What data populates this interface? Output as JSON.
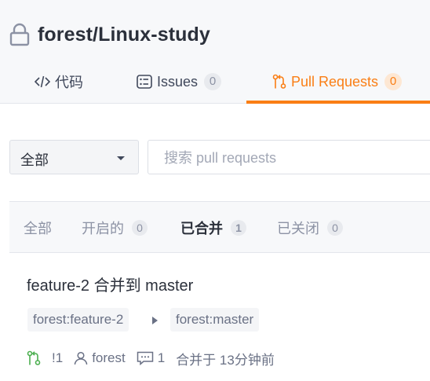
{
  "repo": {
    "title": "forest/Linux-study",
    "icon": "lock-icon"
  },
  "tabs": [
    {
      "label": "代码",
      "icon": "code-icon"
    },
    {
      "label": "Issues",
      "count": "0",
      "icon": "issues-icon"
    },
    {
      "label": "Pull Requests",
      "count": "0",
      "icon": "pull-request-icon",
      "active": true
    }
  ],
  "colors": {
    "accent": "#fa7e14",
    "merged_icon": "#4caf50"
  },
  "toolbar": {
    "select_value": "全部",
    "search_placeholder": "搜索 pull requests"
  },
  "filters": [
    {
      "label": "全部"
    },
    {
      "label": "开启的",
      "count": "0"
    },
    {
      "label": "已合并",
      "count": "1",
      "active": true
    },
    {
      "label": "已关闭",
      "count": "0"
    }
  ],
  "pull_request": {
    "title": "feature-2 合并到 master",
    "source_branch": "forest:feature-2",
    "target_branch": "forest:master",
    "number": "!1",
    "author": "forest",
    "comments": "1",
    "status": "合并于 13分钟前"
  }
}
